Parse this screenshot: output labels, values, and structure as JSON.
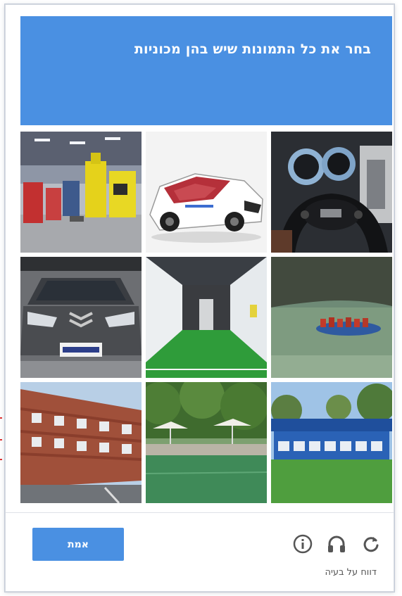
{
  "challenge": {
    "instruction": "בחר את כל התמונות שיש בהן מכוניות",
    "header_color": "#4a90e2"
  },
  "tiles": [
    {
      "id": 1,
      "subject": "workshop with machinery"
    },
    {
      "id": 2,
      "subject": "white race car bed"
    },
    {
      "id": 3,
      "subject": "car steering wheel and dashboard"
    },
    {
      "id": 4,
      "subject": "front of grey Citroen car"
    },
    {
      "id": 5,
      "subject": "indoor turf training field"
    },
    {
      "id": 6,
      "subject": "rafting boat on river"
    },
    {
      "id": 7,
      "subject": "red brick building"
    },
    {
      "id": 8,
      "subject": "lakeside with umbrellas"
    },
    {
      "id": 9,
      "subject": "blue team bench on grass"
    }
  ],
  "footer": {
    "verify_label": "אמת",
    "report_label": "דווח על בעיה",
    "icons": [
      "info-icon",
      "headphones-icon",
      "refresh-icon"
    ]
  }
}
